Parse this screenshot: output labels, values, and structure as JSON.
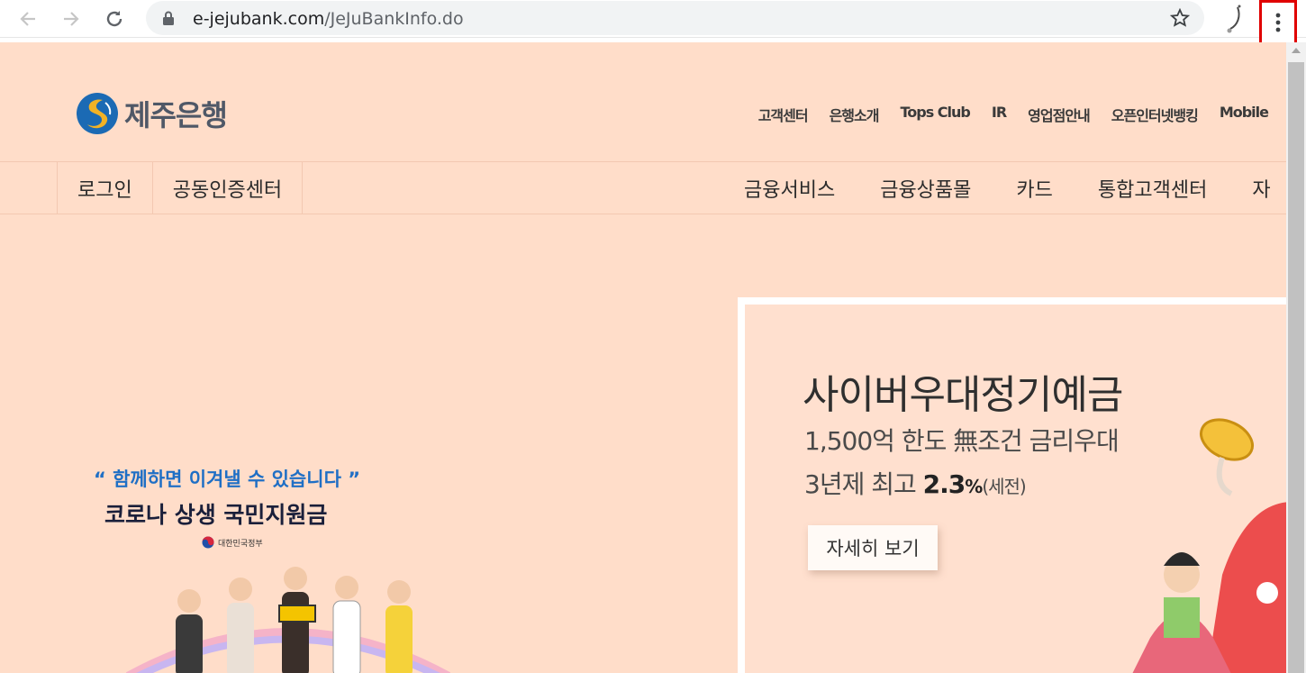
{
  "browser": {
    "url_host": "e-jejubank.com",
    "url_path": "/JeJuBankInfo.do",
    "icons": [
      "back-arrow-icon",
      "forward-arrow-icon",
      "reload-icon",
      "lock-icon",
      "star-icon",
      "menu-kebab-icon"
    ]
  },
  "header": {
    "brand": "제주은행",
    "util_nav": [
      "고객센터",
      "은행소개",
      "Tops Club",
      "IR",
      "영업점안내",
      "오픈인터넷뱅킹",
      "Mobile"
    ]
  },
  "gnb": {
    "left": [
      "로그인",
      "공동인증센터"
    ],
    "right": [
      "금융서비스",
      "금융상품몰",
      "카드",
      "통합고객센터",
      "자"
    ]
  },
  "covid_banner": {
    "slogan": "“ 함께하면 이겨낼 수 있습니다 ”",
    "title": "코로나 상생 국민지원금",
    "gov": "대한민국정부"
  },
  "product_banner": {
    "title": "사이버우대정기예금",
    "line1": "1,500억 한도 無조건 금리우대",
    "line2_prefix": "3년제 최고 ",
    "line2_rate": "2.3",
    "line2_pct": "%",
    "line2_tax": "(세전)",
    "button": "자세히 보기"
  },
  "colors": {
    "page_bg": "#ffddc9",
    "brand_blue": "#1f6fc5",
    "highlight_red": "#e00000"
  }
}
